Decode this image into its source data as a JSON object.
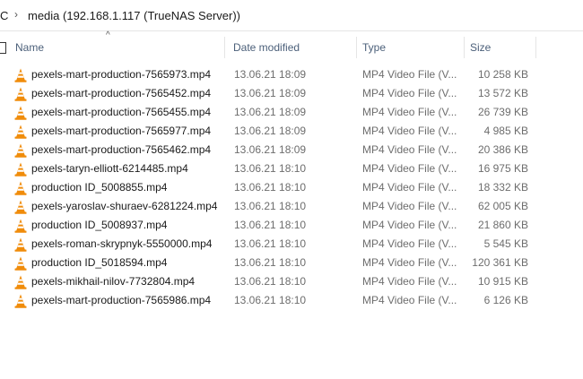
{
  "breadcrumb": {
    "prev": "C",
    "separator": "›",
    "current": "media (192.168.1.117 (TrueNAS Server))"
  },
  "header": {
    "sort_indicator": "^",
    "columns": {
      "name": "Name",
      "date": "Date modified",
      "type": "Type",
      "size": "Size"
    }
  },
  "files": [
    {
      "name": "pexels-mart-production-7565973.mp4",
      "date": "13.06.21 18:09",
      "type": "MP4 Video File (V...",
      "size": "10 258 KB",
      "icon": "vlc-cone-icon"
    },
    {
      "name": "pexels-mart-production-7565452.mp4",
      "date": "13.06.21 18:09",
      "type": "MP4 Video File (V...",
      "size": "13 572 KB",
      "icon": "vlc-cone-icon"
    },
    {
      "name": "pexels-mart-production-7565455.mp4",
      "date": "13.06.21 18:09",
      "type": "MP4 Video File (V...",
      "size": "26 739 KB",
      "icon": "vlc-cone-icon"
    },
    {
      "name": "pexels-mart-production-7565977.mp4",
      "date": "13.06.21 18:09",
      "type": "MP4 Video File (V...",
      "size": "4 985 KB",
      "icon": "vlc-cone-icon"
    },
    {
      "name": "pexels-mart-production-7565462.mp4",
      "date": "13.06.21 18:09",
      "type": "MP4 Video File (V...",
      "size": "20 386 KB",
      "icon": "vlc-cone-icon"
    },
    {
      "name": "pexels-taryn-elliott-6214485.mp4",
      "date": "13.06.21 18:10",
      "type": "MP4 Video File (V...",
      "size": "16 975 KB",
      "icon": "vlc-cone-icon"
    },
    {
      "name": "production ID_5008855.mp4",
      "date": "13.06.21 18:10",
      "type": "MP4 Video File (V...",
      "size": "18 332 KB",
      "icon": "vlc-cone-icon"
    },
    {
      "name": "pexels-yaroslav-shuraev-6281224.mp4",
      "date": "13.06.21 18:10",
      "type": "MP4 Video File (V...",
      "size": "62 005 KB",
      "icon": "vlc-cone-icon"
    },
    {
      "name": "production ID_5008937.mp4",
      "date": "13.06.21 18:10",
      "type": "MP4 Video File (V...",
      "size": "21 860 KB",
      "icon": "vlc-cone-icon"
    },
    {
      "name": "pexels-roman-skrypnyk-5550000.mp4",
      "date": "13.06.21 18:10",
      "type": "MP4 Video File (V...",
      "size": "5 545 KB",
      "icon": "vlc-cone-icon"
    },
    {
      "name": "production ID_5018594.mp4",
      "date": "13.06.21 18:10",
      "type": "MP4 Video File (V...",
      "size": "120 361 KB",
      "icon": "vlc-cone-icon"
    },
    {
      "name": "pexels-mikhail-nilov-7732804.mp4",
      "date": "13.06.21 18:10",
      "type": "MP4 Video File (V...",
      "size": "10 915 KB",
      "icon": "vlc-cone-icon"
    },
    {
      "name": "pexels-mart-production-7565986.mp4",
      "date": "13.06.21 18:10",
      "type": "MP4 Video File (V...",
      "size": "6 126 KB",
      "icon": "vlc-cone-icon"
    }
  ],
  "colors": {
    "vlc_orange": "#f08c0a",
    "header_text": "#4c607a",
    "secondary_text": "#6d6d6d"
  }
}
